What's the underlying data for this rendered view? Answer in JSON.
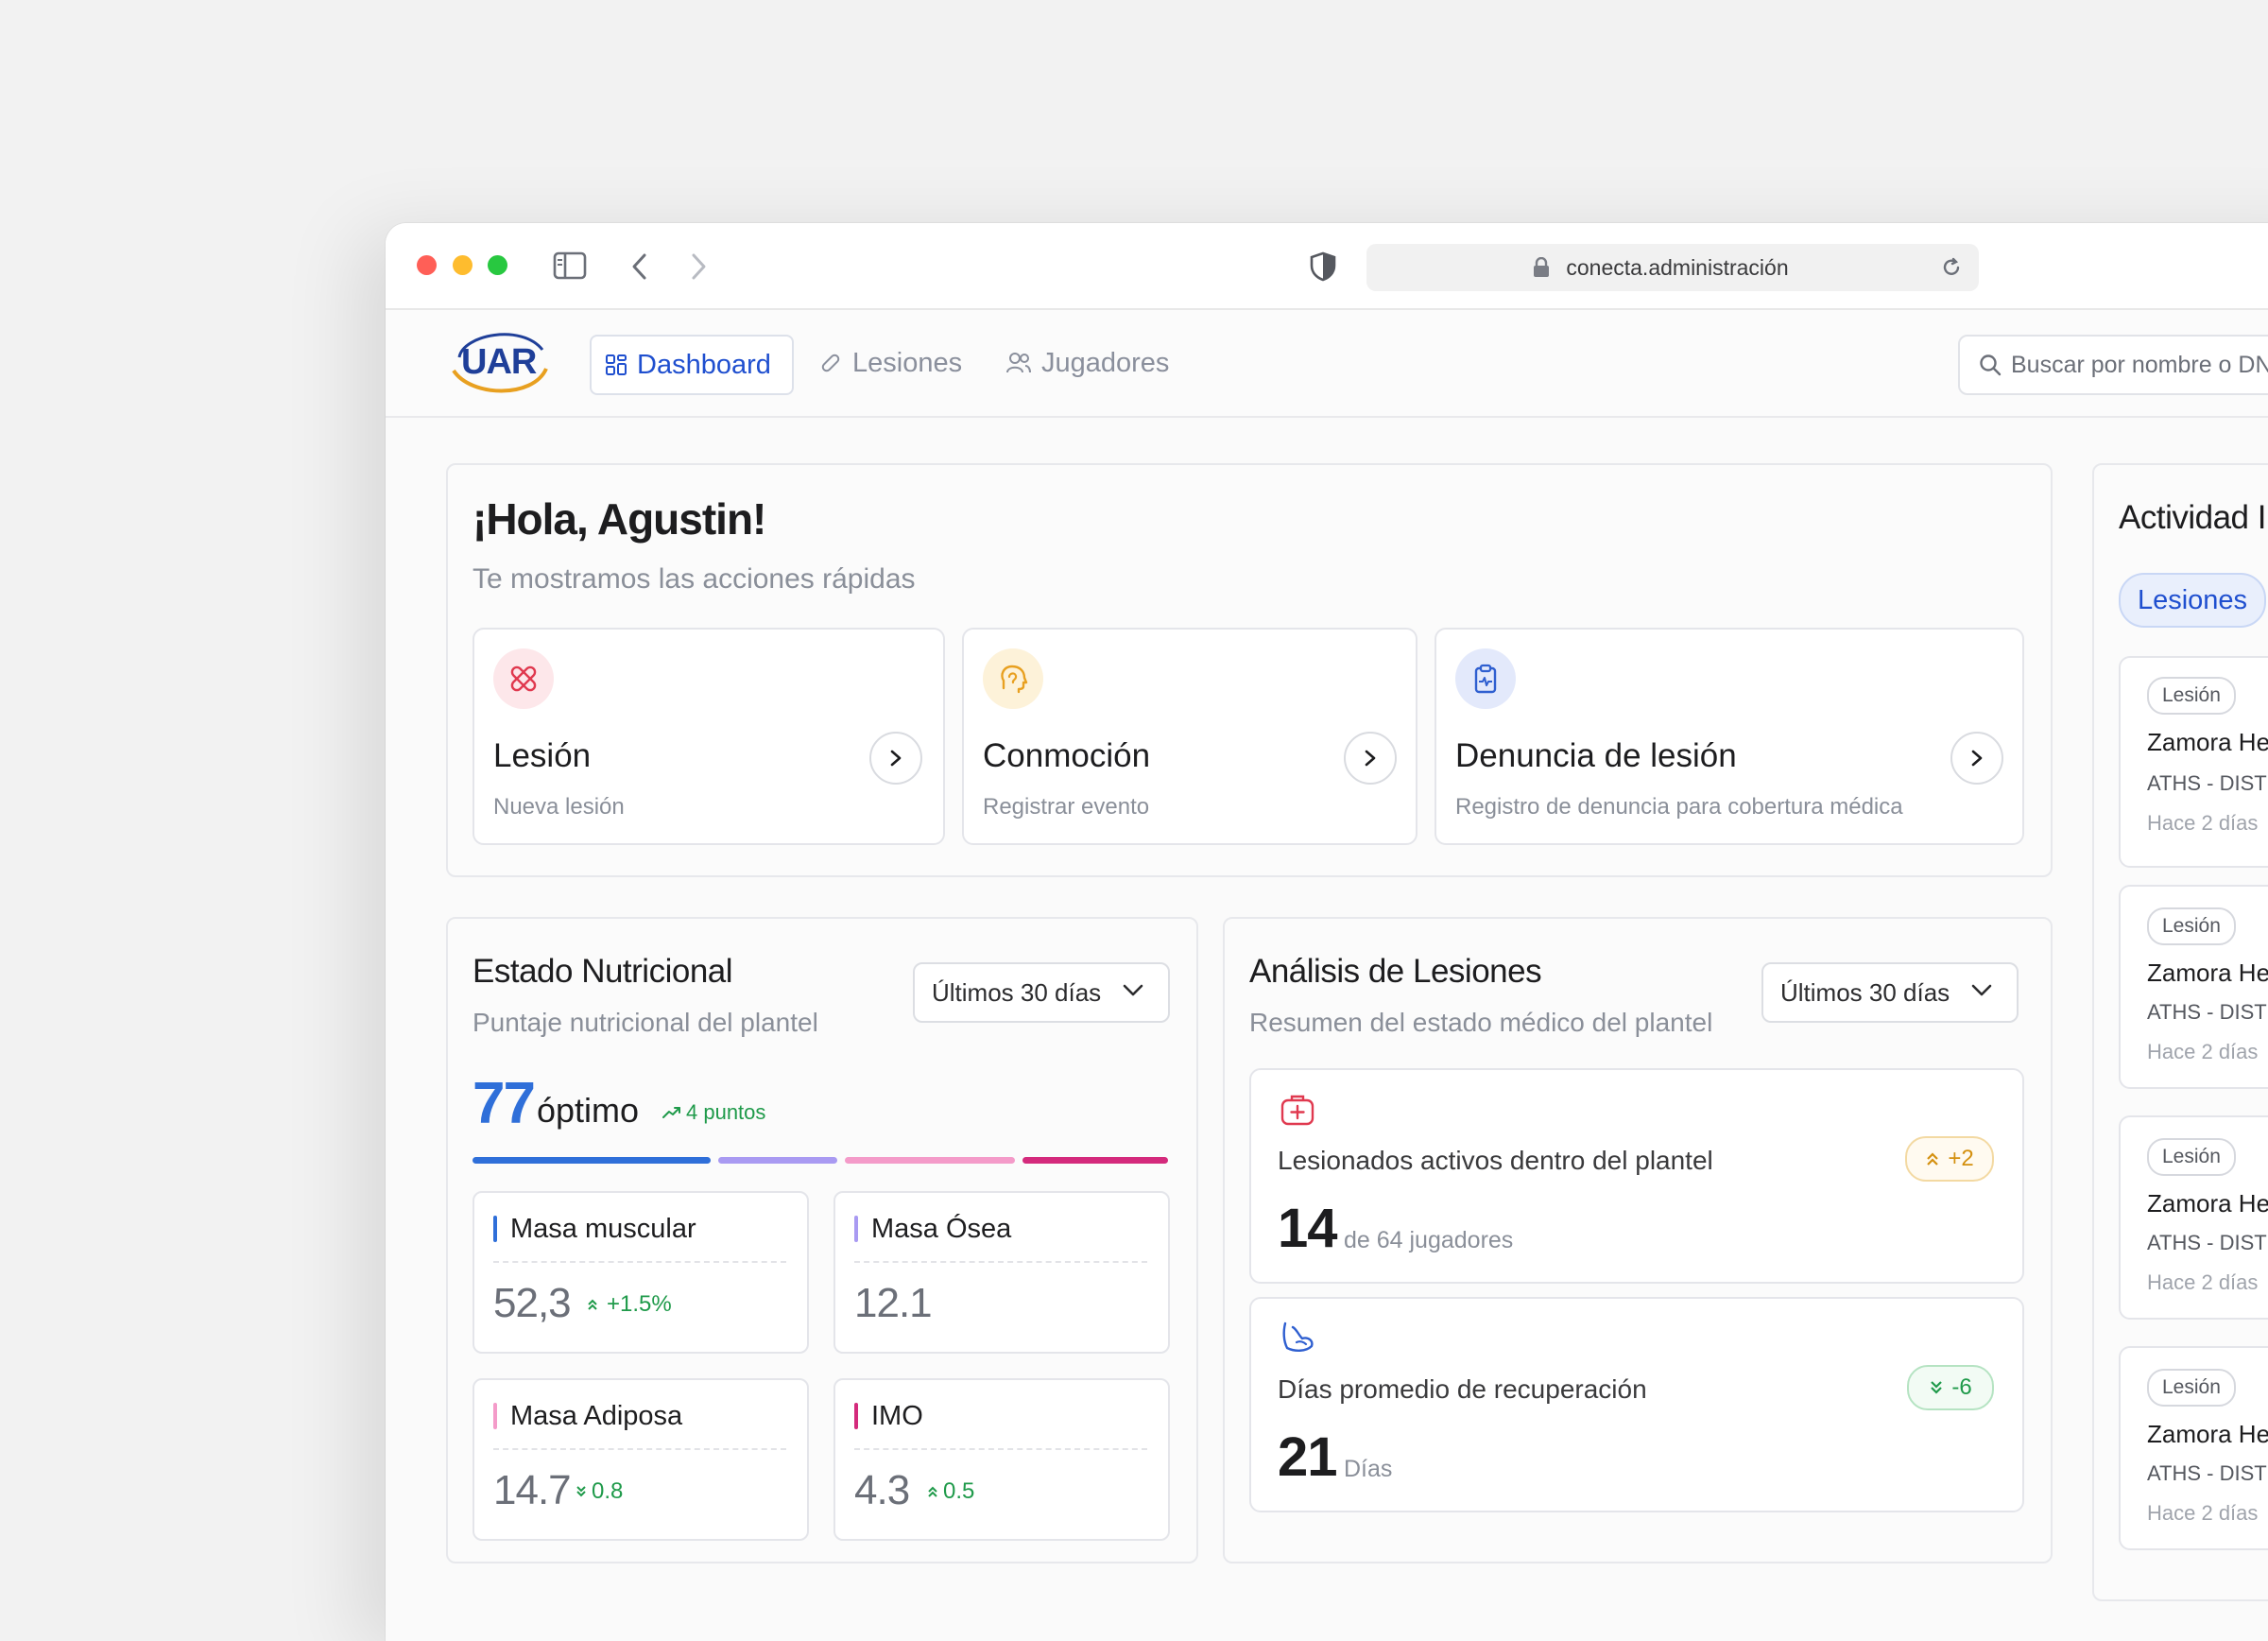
{
  "browser": {
    "url": "conecta.administración"
  },
  "header": {
    "logo": "UAR",
    "nav": [
      {
        "label": "Dashboard",
        "active": true
      },
      {
        "label": "Lesiones",
        "active": false
      },
      {
        "label": "Jugadores",
        "active": false
      }
    ],
    "search_placeholder": "Buscar por nombre o DNI"
  },
  "welcome": {
    "title": "¡Hola, Agustin!",
    "subtitle": "Te mostramos las acciones rápidas",
    "actions": [
      {
        "title": "Lesión",
        "subtitle": "Nueva lesión",
        "icon": "bandage-icon"
      },
      {
        "title": "Conmoción",
        "subtitle": "Registrar evento",
        "icon": "head-icon"
      },
      {
        "title": "Denuncia de lesión",
        "subtitle": "Registro de denuncia para cobertura médica",
        "icon": "clipboard-icon"
      }
    ]
  },
  "nutrition": {
    "title": "Estado Nutricional",
    "subtitle": "Puntaje nutricional del plantel",
    "period": "Últimos 30 días",
    "score": "77",
    "status": "óptimo",
    "trend": "4 puntos",
    "bar_colors": [
      "#2f6fd9",
      "#a99af2",
      "#f49bc9",
      "#d42a7c"
    ],
    "metrics": [
      {
        "label": "Masa muscular",
        "value": "52,3",
        "delta": "+1.5%",
        "color": "#2f6fd9"
      },
      {
        "label": "Masa Ósea",
        "value": "12.1",
        "delta": "",
        "color": "#a99af2"
      },
      {
        "label": "Masa Adiposa",
        "value": "14.7",
        "delta": "0.8",
        "color": "#f49bc9"
      },
      {
        "label": "IMO",
        "value": "4.3",
        "delta": "0.5",
        "color": "#d42a7c"
      }
    ]
  },
  "injuries": {
    "title": "Análisis de Lesiones",
    "subtitle": "Resumen del estado médico del plantel",
    "period": "Últimos 30 días",
    "stats": [
      {
        "label": "Lesionados activos dentro del plantel",
        "value": "14",
        "unit": "de 64 jugadores",
        "badge": "+2",
        "icon": "medkit-icon"
      },
      {
        "label": "Días promedio de recuperación",
        "value": "21",
        "unit": "Días",
        "badge": "-6",
        "icon": "muscle-icon"
      }
    ]
  },
  "activity": {
    "title": "Actividad I",
    "filter": "Lesiones",
    "items": [
      {
        "tag": "Lesión",
        "name": "Zamora Her",
        "team": "ATHS - DISTE",
        "time": "Hace 2 días"
      },
      {
        "tag": "Lesión",
        "name": "Zamora Her",
        "team": "ATHS - DISTE",
        "time": "Hace 2 días"
      },
      {
        "tag": "Lesión",
        "name": "Zamora Her",
        "team": "ATHS - DISTE",
        "time": "Hace 2 días"
      },
      {
        "tag": "Lesión",
        "name": "Zamora Her",
        "team": "ATHS - DISTE",
        "time": "Hace 2 días"
      }
    ]
  }
}
